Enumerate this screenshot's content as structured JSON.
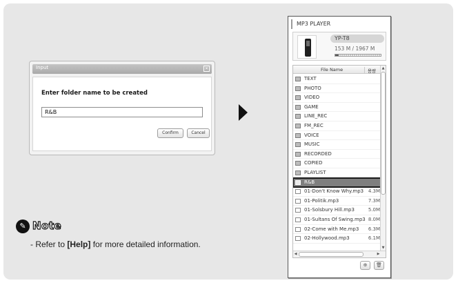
{
  "dialog": {
    "title": "Input",
    "close_glyph": "✕",
    "prompt": "Enter folder name to be created",
    "value": "R&B",
    "confirm_label": "Confirm",
    "cancel_label": "Cancel"
  },
  "note": {
    "icon_glyph": "✎",
    "title": "Note",
    "line_prefix": "- Refer to ",
    "line_bold": "[Help]",
    "line_suffix": " for more detailed information."
  },
  "player": {
    "title": "MP3 PLAYER",
    "device_name": "YP-T8",
    "storage": "153 M / 1967 M",
    "storage_fraction": 0.078,
    "columns": {
      "name": "File Name",
      "size": "용량"
    },
    "rows": [
      {
        "name": "TEXT",
        "type": "folder",
        "size": ""
      },
      {
        "name": "PHOTO",
        "type": "folder",
        "size": ""
      },
      {
        "name": "VIDEO",
        "type": "folder",
        "size": ""
      },
      {
        "name": "GAME",
        "type": "folder",
        "size": ""
      },
      {
        "name": "LINE_REC",
        "type": "folder",
        "size": ""
      },
      {
        "name": "FM_REC",
        "type": "folder",
        "size": ""
      },
      {
        "name": "VOICE",
        "type": "folder",
        "size": ""
      },
      {
        "name": "MUSIC",
        "type": "folder",
        "size": ""
      },
      {
        "name": "RECORDED",
        "type": "folder",
        "size": ""
      },
      {
        "name": "COPIED",
        "type": "folder",
        "size": ""
      },
      {
        "name": "PLAYLIST",
        "type": "folder",
        "size": ""
      },
      {
        "name": "R&B",
        "type": "folder",
        "size": "",
        "selected": true
      },
      {
        "name": "01-Don't Know Why.mp3",
        "type": "file",
        "size": "4.3M"
      },
      {
        "name": "01-Politik.mp3",
        "type": "file",
        "size": "7.3M"
      },
      {
        "name": "01-Solsbury Hill.mp3",
        "type": "file",
        "size": "5.0M"
      },
      {
        "name": "01-Sultans Of Swing.mp3",
        "type": "file",
        "size": "8.0M"
      },
      {
        "name": "02-Come with Me.mp3",
        "type": "file",
        "size": "6.3M"
      },
      {
        "name": "02-Hollywood.mp3",
        "type": "file",
        "size": "6.1M"
      }
    ],
    "buttons": {
      "new_folder_glyph": "⊕",
      "delete_glyph": "🗑"
    }
  }
}
